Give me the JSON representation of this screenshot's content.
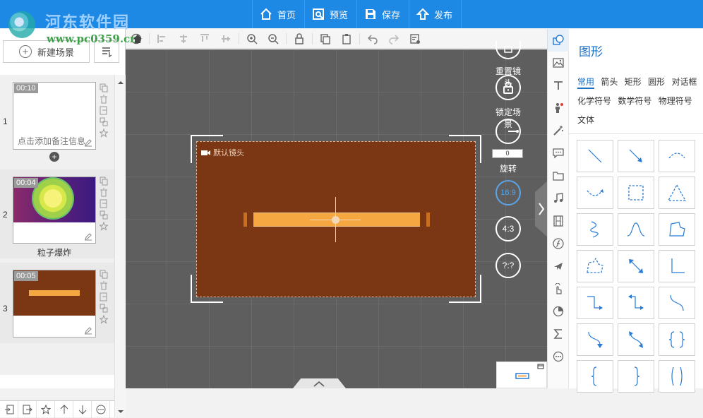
{
  "watermark": {
    "site_name": "河东软件园",
    "url": "www.pc0359.cn"
  },
  "topnav": [
    {
      "label": "首页",
      "icon": "home-icon"
    },
    {
      "label": "预览",
      "icon": "preview-icon"
    },
    {
      "label": "保存",
      "icon": "save-icon"
    },
    {
      "label": "发布",
      "icon": "publish-icon"
    }
  ],
  "left": {
    "new_scene_label": "新建场景",
    "scenes": [
      {
        "index": "1",
        "time": "00:10",
        "note": "点击添加备注信息",
        "label": ""
      },
      {
        "index": "2",
        "time": "00:04",
        "note": "",
        "label": "粒子爆炸"
      },
      {
        "index": "3",
        "time": "00:05",
        "note": "",
        "label": ""
      }
    ]
  },
  "canvas": {
    "camera_label": "默认镜头",
    "controls": {
      "reset_label": "重置镜头",
      "lock_label": "锁定场景",
      "rotate_label": "旋转",
      "rotate_value": "0",
      "ratio_16_9": "16:9",
      "ratio_4_3": "4:3",
      "ratio_custom": "?:?"
    }
  },
  "right": {
    "title": "图形",
    "tabs": [
      "常用",
      "箭头",
      "矩形",
      "圆形",
      "对话框",
      "化学符号",
      "数学符号",
      "物理符号",
      "文体"
    ],
    "active_tab": "常用"
  },
  "colors": {
    "topbar": "#1e88e5",
    "canvas_bg": "#5e5e5e",
    "frame_bg": "#7b3713",
    "bar": "#f5a742",
    "accent": "#1f6fbf"
  }
}
